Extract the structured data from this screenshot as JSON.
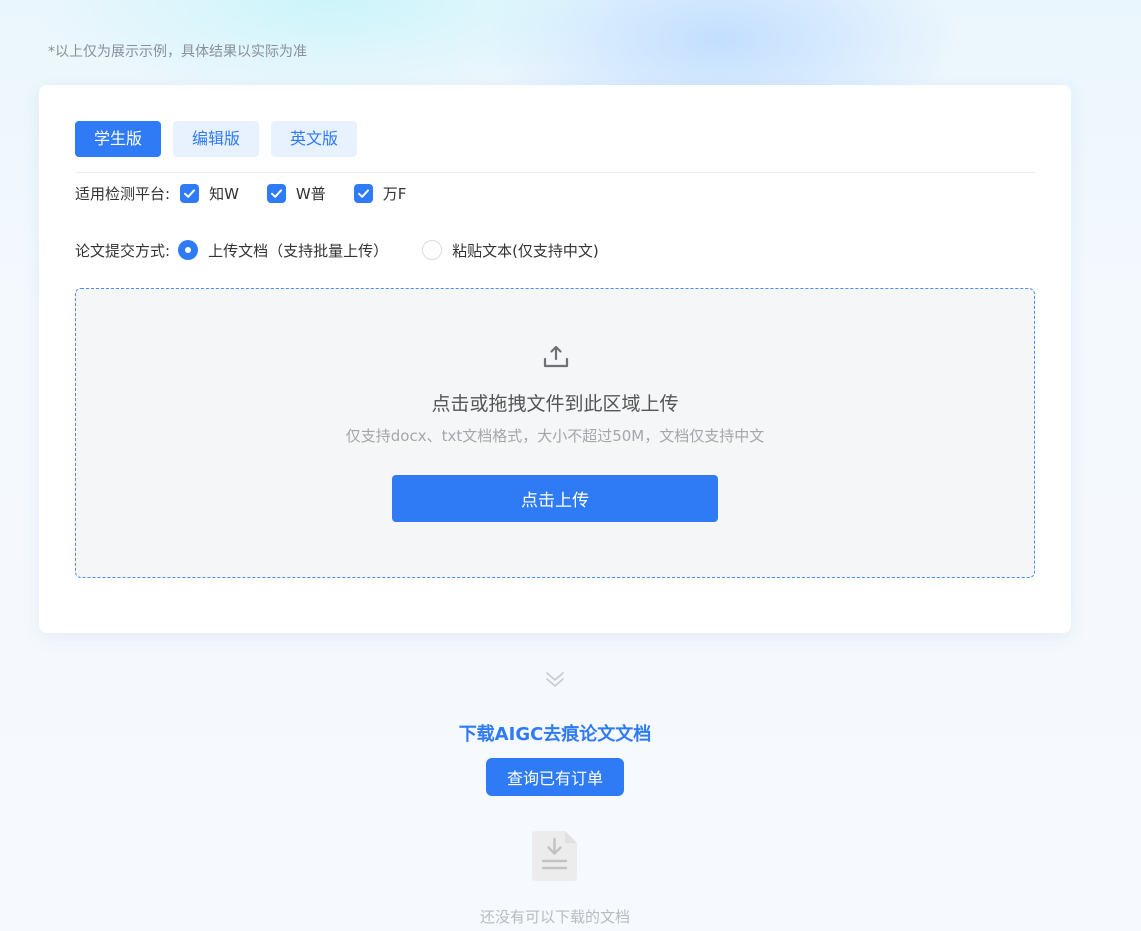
{
  "disclaimer": "*以上仅为展示示例，具体结果以实际为准",
  "tabs": [
    {
      "label": "学生版",
      "active": true
    },
    {
      "label": "编辑版",
      "active": false
    },
    {
      "label": "英文版",
      "active": false
    }
  ],
  "platforms": {
    "label": "适用检测平台:",
    "options": [
      {
        "label": "知W",
        "checked": true
      },
      {
        "label": "W普",
        "checked": true
      },
      {
        "label": "万F",
        "checked": true
      }
    ]
  },
  "submit_method": {
    "label": "论文提交方式:",
    "options": [
      {
        "label": "上传文档（支持批量上传）",
        "selected": true
      },
      {
        "label": "粘贴文本(仅支持中文)",
        "selected": false
      }
    ]
  },
  "dropzone": {
    "icon": "upload-icon",
    "title": "点击或拖拽文件到此区域上传",
    "hint": "仅支持docx、txt文档格式，大小不超过50M，文档仅支持中文",
    "button_label": "点击上传"
  },
  "download": {
    "chevron_icon": "double-chevron-down-icon",
    "title": "下载AIGC去痕论文文档",
    "query_button_label": "查询已有订单",
    "empty_icon": "download-document-icon",
    "empty_text": "还没有可以下载的文档"
  },
  "colors": {
    "primary": "#2f7bf5",
    "tab_inactive_bg": "#e8f1fe",
    "muted_text": "#a2a6ad"
  }
}
